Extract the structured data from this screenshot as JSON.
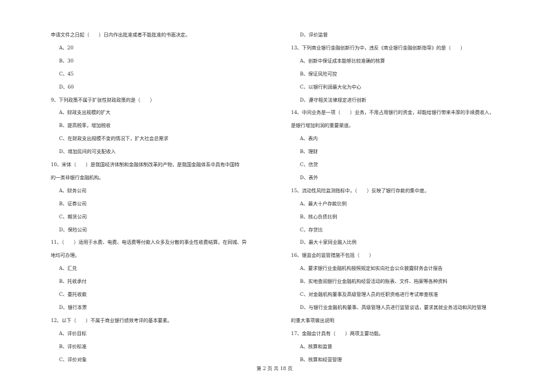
{
  "page": {
    "footer": "第 2 页 共 18 页"
  },
  "left_column": [
    {
      "text": "申请文件之日起（　　）日内作出批准或者不能批准的书面决定。",
      "kind": "q"
    },
    {
      "text": "A、20",
      "kind": "opt"
    },
    {
      "text": "B、30",
      "kind": "opt"
    },
    {
      "text": "C、45",
      "kind": "opt"
    },
    {
      "text": "D、60",
      "kind": "opt"
    },
    {
      "text": "9、下列政策不属于扩张性财政政策的是（　　）",
      "kind": "q"
    },
    {
      "text": "A、财政支出规模的扩大",
      "kind": "opt"
    },
    {
      "text": "B、提高税率，增加税收",
      "kind": "opt"
    },
    {
      "text": "C、在财政支出规模不变的情况下，扩大社会总需求",
      "kind": "opt"
    },
    {
      "text": "D、增加民间的可支配收入",
      "kind": "opt"
    },
    {
      "text": "10、宋体（　　）是我国经济体制和金融体制改革的产物，是我国金融体系中具有中国特",
      "kind": "q"
    },
    {
      "text": "的一类非银行金融机构。",
      "kind": "q"
    },
    {
      "text": "A、财务公司",
      "kind": "opt"
    },
    {
      "text": "B、证券公司",
      "kind": "opt"
    },
    {
      "text": "C、期货公司",
      "kind": "opt"
    },
    {
      "text": "D、保险公司",
      "kind": "opt"
    },
    {
      "text": "11、（　　）适用于水费、电费、电话费等付款人众多及分散的事业性收费结算。在同城、异",
      "kind": "q"
    },
    {
      "text": "地均可办理。",
      "kind": "q"
    },
    {
      "text": "A、汇兑",
      "kind": "opt"
    },
    {
      "text": "B、托收承付",
      "kind": "opt"
    },
    {
      "text": "C、委托收款",
      "kind": "opt"
    },
    {
      "text": "D、银行本票",
      "kind": "opt"
    },
    {
      "text": "12、以下（　　）不属于商业银行绩效考评的基本要素。",
      "kind": "q"
    },
    {
      "text": "A、评价目标",
      "kind": "opt"
    },
    {
      "text": "B、评价标准",
      "kind": "opt"
    },
    {
      "text": "C、评价对象",
      "kind": "opt"
    }
  ],
  "right_column": [
    {
      "text": "D、评价监督",
      "kind": "opt"
    },
    {
      "text": "13、下列商业银行金融创新行为中，违反《商业银行金融创新指导》的是（　　）",
      "kind": "q"
    },
    {
      "text": "A、创新中保证成本能够比较准确的核算",
      "kind": "opt"
    },
    {
      "text": "B、保证风险可控",
      "kind": "opt"
    },
    {
      "text": "C、以银行利润最大化为中心",
      "kind": "opt"
    },
    {
      "text": "D、遵守相关法律规定进行创新",
      "kind": "opt"
    },
    {
      "text": "14、中间业务是一项（　　）业务，不用占用银行的资金，却能给银行带来丰厚的手续费收入，",
      "kind": "q"
    },
    {
      "text": "是银行增加利润的重要渠道。",
      "kind": "q"
    },
    {
      "text": "A、表内",
      "kind": "opt"
    },
    {
      "text": "B、理财",
      "kind": "opt"
    },
    {
      "text": "C、信贷",
      "kind": "opt"
    },
    {
      "text": "D、表外",
      "kind": "opt"
    },
    {
      "text": "15、流动性风险监测指标中，（　　）反映了银行存款的集中度。",
      "kind": "q"
    },
    {
      "text": "A、最大十户存款比例",
      "kind": "opt"
    },
    {
      "text": "B、核心负债比例",
      "kind": "opt"
    },
    {
      "text": "C、存贷比",
      "kind": "opt"
    },
    {
      "text": "D、最大十家同业融入比例",
      "kind": "opt"
    },
    {
      "text": "16、银监会的监管措施不包括（　　）",
      "kind": "q"
    },
    {
      "text": "A、要求银行业金融机构按照规定如实向社会公众披露财务会计报告",
      "kind": "opt"
    },
    {
      "text": "B、实地查阅银行业金融机构经营活动的账表、文件、档案等各种资料",
      "kind": "opt"
    },
    {
      "text": "C、对金融机构董事及高级管理人员的任职资格进行考试审查核准",
      "kind": "opt"
    },
    {
      "text": "D、与银行业金融机构董事、高级管理人员进行监管谈话，要求其就业务活动和风险管理",
      "kind": "opt"
    },
    {
      "text": "的重大事项做出说明",
      "kind": "q"
    },
    {
      "text": "17、金融会计具有（　　）两项主要功能。",
      "kind": "q"
    },
    {
      "text": "A、核算和监督",
      "kind": "opt"
    },
    {
      "text": "B、核算和经营管理",
      "kind": "opt"
    }
  ]
}
